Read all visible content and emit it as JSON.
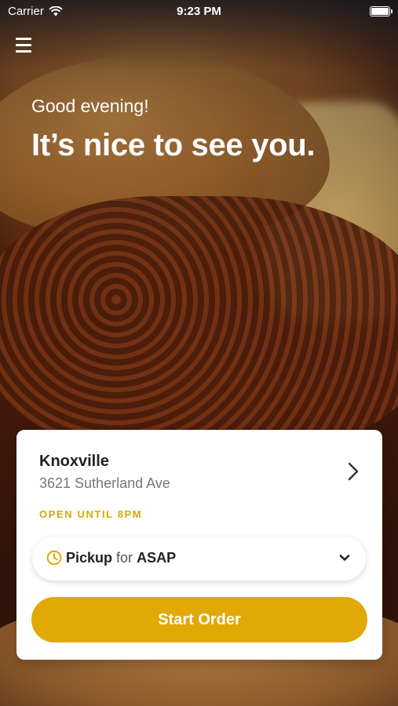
{
  "status_bar": {
    "carrier": "Carrier",
    "time": "9:23 PM"
  },
  "header": {
    "menu_icon": "hamburger-menu-icon",
    "greeting": "Good evening!",
    "headline": "It’s nice to see you."
  },
  "location_card": {
    "name": "Knoxville",
    "address": "3621 Sutherland Ave",
    "hours_status": "OPEN UNTIL 8PM",
    "pickup": {
      "mode": "Pickup",
      "connector": "for",
      "time": "ASAP",
      "icon": "clock-icon"
    },
    "start_order_label": "Start Order"
  },
  "colors": {
    "accent": "#e1a806",
    "hours_text": "#d8a806"
  }
}
